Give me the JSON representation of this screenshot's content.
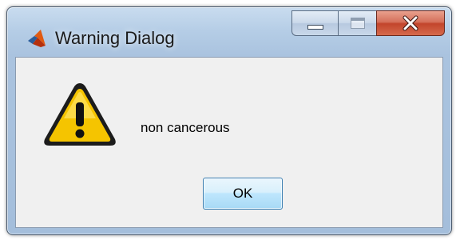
{
  "window": {
    "title": "Warning Dialog",
    "app_icon": "matlab-logo-icon",
    "caption_buttons": {
      "minimize": "minimize-icon",
      "maximize": "maximize-icon",
      "close": "close-icon"
    }
  },
  "dialog": {
    "icon": "warning-icon",
    "message": "non cancerous",
    "ok_label": "OK"
  },
  "colors": {
    "warning_fill": "#f5c400",
    "close_button": "#c2452c",
    "ok_border": "#3c7fb1",
    "content_bg": "#f0f0f0"
  }
}
